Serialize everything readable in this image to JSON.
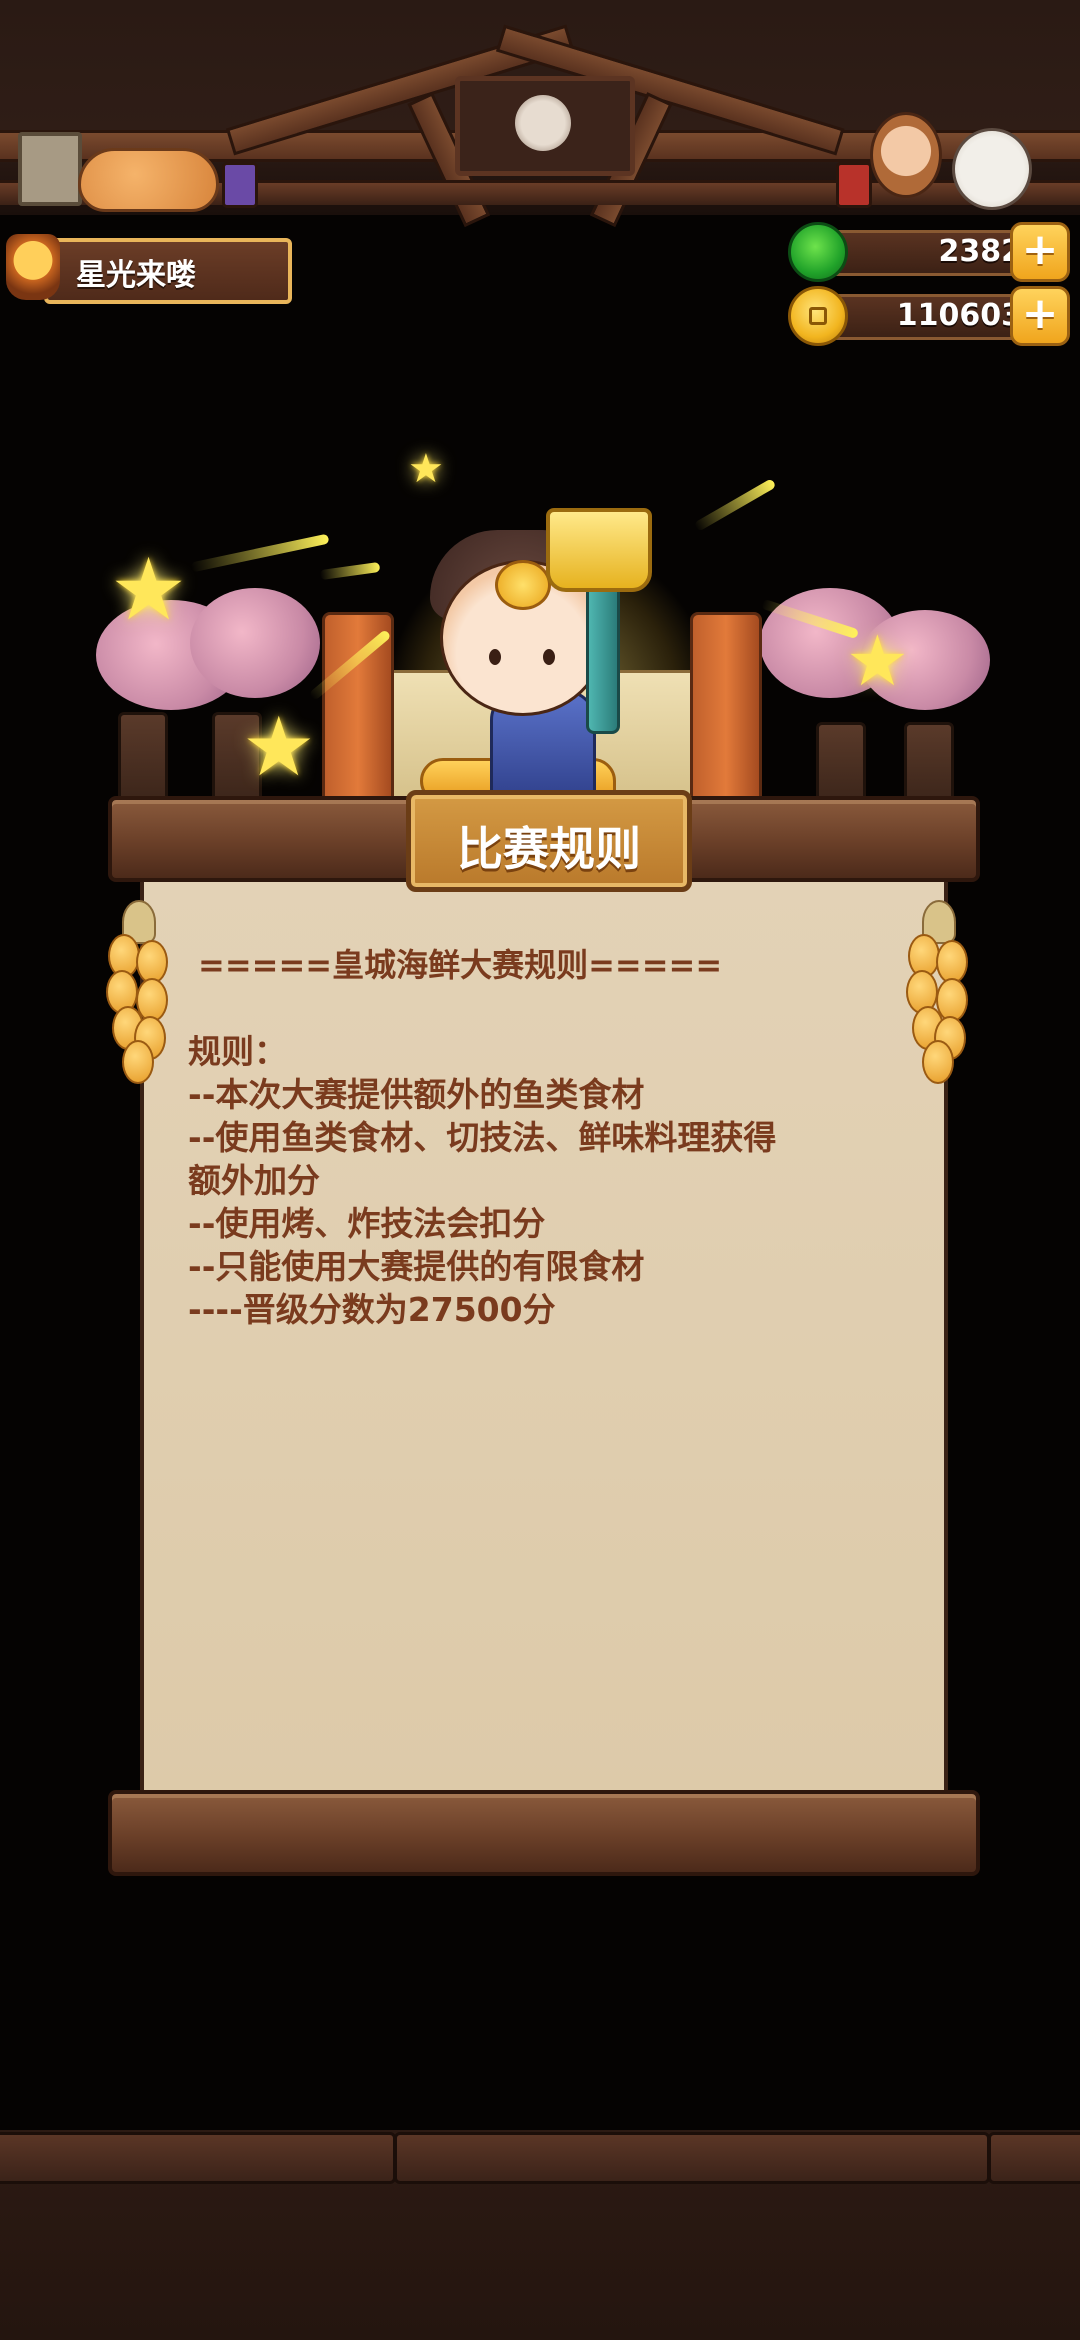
{
  "player": {
    "name": "星光来喽"
  },
  "currency": [
    {
      "name": "green",
      "value": "2382",
      "add": "+"
    },
    {
      "name": "coin",
      "value": "110603",
      "add": "+"
    }
  ],
  "panel": {
    "title": "比赛规则",
    "heading": "=====皇城海鲜大赛规则=====",
    "lines": [
      "规则：",
      "--本次大赛提供额外的鱼类食材",
      "--使用鱼类食材、切技法、鲜味料理获得",
      "额外加分",
      "--使用烤、炸技法会扣分",
      "--只能使用大赛提供的有限食材",
      "----晋级分数为27500分"
    ]
  },
  "colors": {
    "text_brown": "#7a3b1e",
    "paper": "#e3d2b6",
    "gold": "#f0a51d",
    "background": "#050302"
  },
  "icons": {
    "avatar": "chef-avatar-icon",
    "green_currency": "green-gem-icon",
    "coin_currency": "coin-icon",
    "plus": "plus-icon"
  }
}
